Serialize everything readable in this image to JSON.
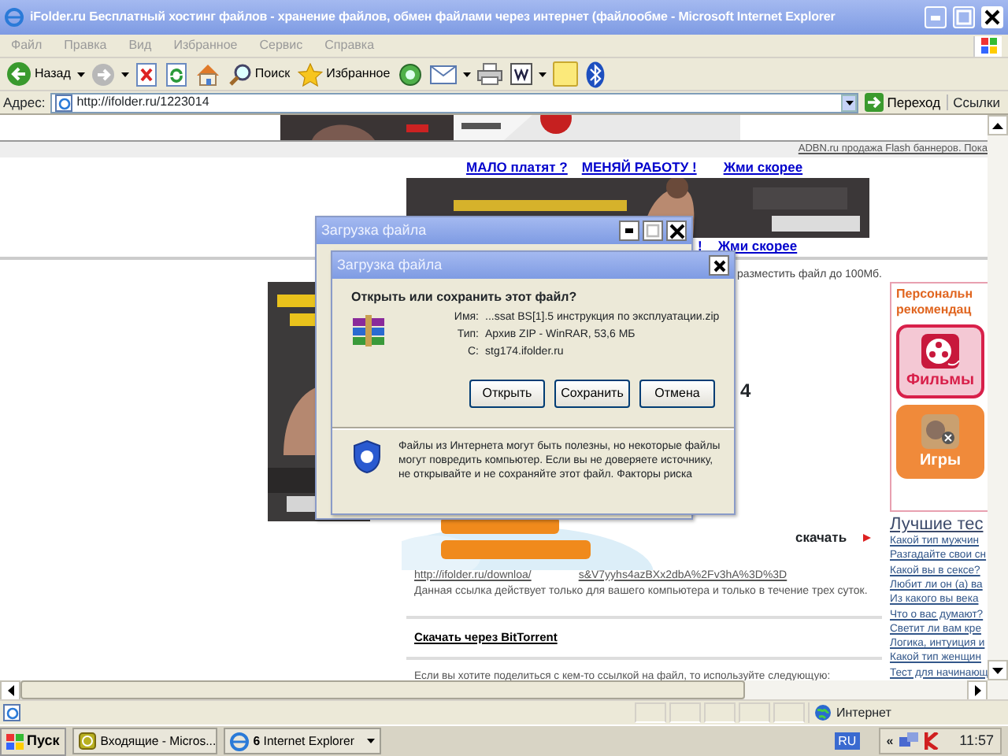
{
  "window": {
    "title": "iFolder.ru Бесплатный хостинг файлов - хранение файлов, обмен файлами через интернет (файлообме - Microsoft Internet Explorer"
  },
  "menu": [
    "Файл",
    "Правка",
    "Вид",
    "Избранное",
    "Сервис",
    "Справка"
  ],
  "toolbar": {
    "back_label": "Назад",
    "search_label": "Поиск",
    "favorites_label": "Избранное"
  },
  "address_bar": {
    "label": "Адрес:",
    "value": "http://ifolder.ru/1223014",
    "go_label": "Переход",
    "links_label": "Ссылки"
  },
  "page": {
    "ad_credit": "ADBN.ru продажа Flash баннеров. Пока",
    "ad_links": [
      "МАЛО платят ?",
      "МЕНЯЙ РАБОТУ !",
      "Жми скорее"
    ],
    "ad_links_2": [
      "!",
      "Жми скорее"
    ],
    "upload_note": "разместить файл до 100Мб.",
    "digit": "4",
    "recommend": {
      "title_lines": [
        "Персональн",
        "рекомендац"
      ],
      "tiles": [
        {
          "label": "Фильмы",
          "kind": "films"
        },
        {
          "label": "Игры",
          "kind": "games"
        }
      ]
    },
    "download_label": "скачать",
    "tests": {
      "title": "Лучшие тес",
      "items": [
        "Какой тип мужчин",
        "Разгадайте свои сн",
        "Какой вы в сексе?",
        "Любит ли он (а) ва",
        "Из какого вы века",
        "Что о вас думают?",
        "Светит ли вам кре",
        "Логика, интуиция и",
        "Какой тип женщин",
        "Тест для начинающ"
      ]
    },
    "link_parts": [
      "http://ifolder.ru/downloa/",
      "s&V7yyhs4azBXx2dbA%2Fv3hA%3D%3D"
    ],
    "link_note": "Данная ссылка действует только для вашего компьютера и только в течение трех суток.",
    "torrent_link": "Скачать через BitTorrent",
    "share_note": "Если вы хотите поделиться с кем-то ссылкой на файл, то используйте следующую:"
  },
  "back_dialog": {
    "title": "Загрузка файла"
  },
  "dialog": {
    "title": "Загрузка файла",
    "question": "Открыть или сохранить этот файл?",
    "fields": [
      {
        "label": "Имя:",
        "value": "...ssat BS[1].5 инструкция по эксплуатации.zip"
      },
      {
        "label": "Тип:",
        "value": "Архив ZIP - WinRAR, 53,6 МБ"
      },
      {
        "label": "С:",
        "value": "stg174.ifolder.ru"
      }
    ],
    "buttons": [
      "Открыть",
      "Сохранить",
      "Отмена"
    ],
    "warning": "Файлы из Интернета могут быть полезны, но некоторые файлы могут повредить компьютер. Если вы не доверяете источнику, не открывайте и не сохраняйте этот файл.",
    "risk_link": "Факторы риска"
  },
  "status_bar": {
    "zone": "Интернет"
  },
  "taskbar": {
    "start": "Пуск",
    "tasks": [
      {
        "label": "Входящие - Micros...",
        "selected": false
      },
      {
        "label": "**6** Internet Explorer",
        "selected": false
      }
    ],
    "language": "RU",
    "tray_expand": "«",
    "clock": "11:57"
  }
}
